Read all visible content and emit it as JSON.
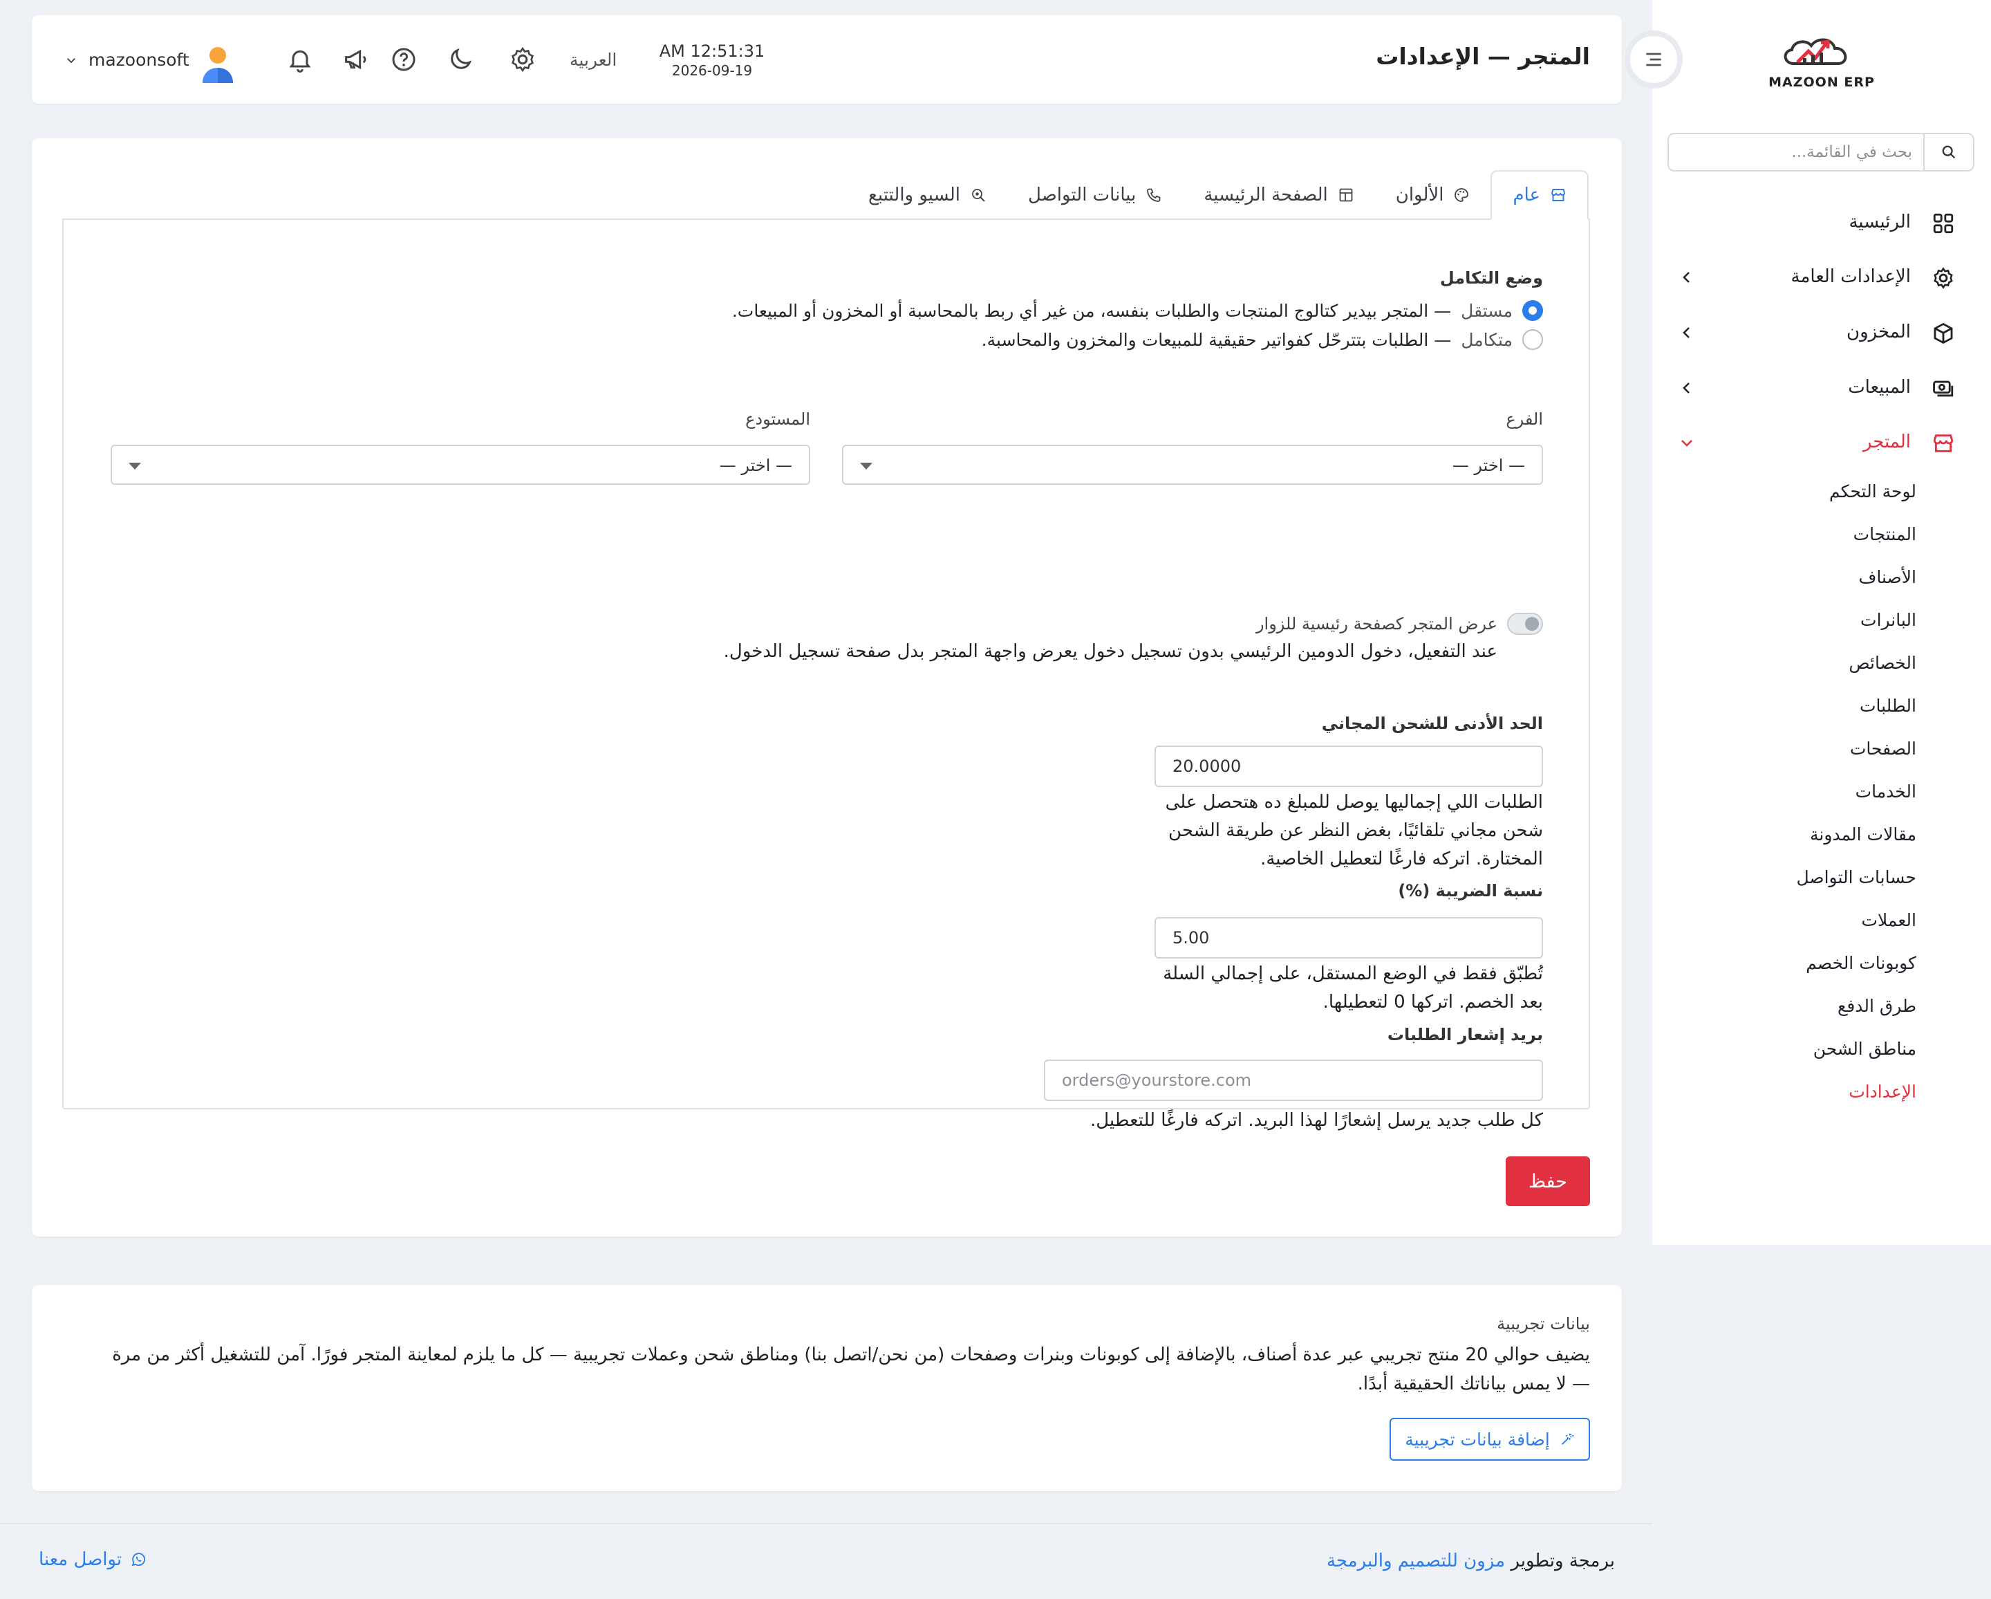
{
  "app": {
    "logo_text": "MAZOON ERP",
    "accent": "#e1303f",
    "primary": "#2b7de9"
  },
  "sidebar": {
    "search_placeholder": "بحث في القائمة...",
    "items": [
      {
        "label": "الرئيسية",
        "icon": "grid-icon"
      },
      {
        "label": "الإعدادات العامة",
        "icon": "gear-icon"
      },
      {
        "label": "المخزون",
        "icon": "box-icon"
      },
      {
        "label": "المبيعات",
        "icon": "cash-icon"
      },
      {
        "label": "المتجر",
        "icon": "store-icon"
      }
    ],
    "store_sub": [
      "لوحة التحكم",
      "المنتجات",
      "الأصناف",
      "البانرات",
      "الخصائص",
      "الطلبات",
      "الصفحات",
      "الخدمات",
      "مقالات المدونة",
      "حسابات التواصل",
      "العملات",
      "كوبونات الخصم",
      "طرق الدفع",
      "مناطق الشحن",
      "الإعدادات"
    ]
  },
  "topbar": {
    "title": "المتجر — الإعدادات",
    "time": "AM 12:51:31",
    "date": "2026-09-19",
    "language": "العربية",
    "username": "mazoonsoft"
  },
  "tabs": [
    {
      "label": "عام",
      "icon": "store-icon"
    },
    {
      "label": "الألوان",
      "icon": "palette-icon"
    },
    {
      "label": "الصفحة الرئيسية",
      "icon": "layout-icon"
    },
    {
      "label": "بيانات التواصل",
      "icon": "phone-icon"
    },
    {
      "label": "السيو والتتبع",
      "icon": "search-zoom-icon"
    }
  ],
  "form": {
    "integration_label": "وضع التكامل",
    "mode_standalone_title": "مستقل",
    "mode_standalone_desc": "— المتجر بيدير كتالوج المنتجات والطلبات بنفسه، من غير أي ربط بالمحاسبة أو المخزون أو المبيعات.",
    "mode_integrated_title": "متكامل",
    "mode_integrated_desc": "— الطلبات بتترحّل كفواتير حقيقية للمبيعات والمخزون والمحاسبة.",
    "branch_label": "الفرع",
    "branch_value": "— اختر —",
    "warehouse_label": "المستودع",
    "warehouse_value": "— اختر —",
    "homepage_toggle_label": "عرض المتجر كصفحة رئيسية للزوار",
    "homepage_toggle_help": "عند التفعيل، دخول الدومين الرئيسي بدون تسجيل دخول يعرض واجهة المتجر بدل صفحة تسجيل الدخول.",
    "free_shipping_label": "الحد الأدنى للشحن المجاني",
    "free_shipping_value": "20.0000",
    "free_shipping_help_1": "الطلبات اللي إجماليها يوصل للمبلغ ده هتحصل على",
    "free_shipping_help_2": "شحن مجاني تلقائيًا، بغض النظر عن طريقة الشحن",
    "free_shipping_help_3": "المختارة. اتركه فارغًا لتعطيل الخاصية.",
    "tax_label": "نسبة الضريبة (%)",
    "tax_value": "5.00",
    "tax_help_1": "تُطبّق فقط في الوضع المستقل، على إجمالي السلة",
    "tax_help_2": "بعد الخصم. اتركها 0 لتعطيلها.",
    "email_label": "بريد إشعار الطلبات",
    "email_placeholder": "orders@yourstore.com",
    "email_help": "كل طلب جديد يرسل إشعارًا لهذا البريد. اتركه فارغًا للتعطيل.",
    "save_label": "حفظ"
  },
  "demo": {
    "title": "بيانات تجريبية",
    "description": "يضيف حوالي 20 منتج تجريبي عبر عدة أصناف، بالإضافة إلى كوبونات وبنرات وصفحات (من نحن/اتصل بنا) ومناطق شحن وعملات تجريبية — كل ما يلزم لمعاينة المتجر فورًا. آمن للتشغيل أكثر من مرة — لا يمس بياناتك الحقيقية أبدًا.",
    "button_label": "إضافة بيانات تجريبية"
  },
  "footer": {
    "credit_prefix": "برمجة وتطوير",
    "credit_link": "مزون للتصميم والبرمجة",
    "contact_label": "تواصل معنا"
  }
}
